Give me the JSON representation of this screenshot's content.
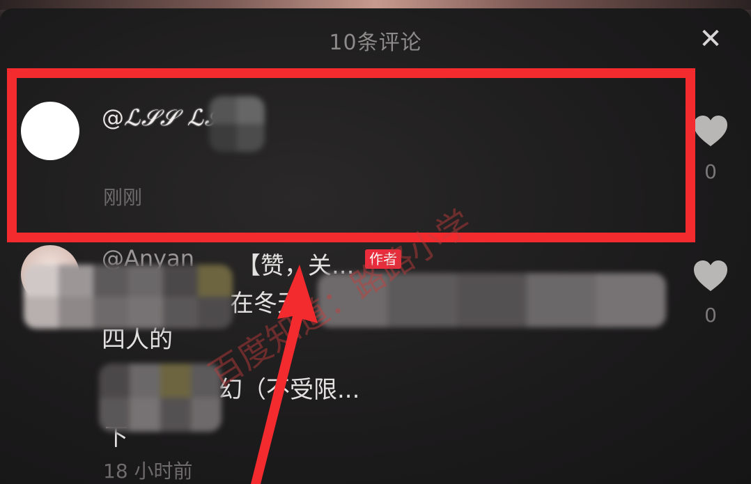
{
  "sheet": {
    "title": "10条评论",
    "close_symbol": "✕"
  },
  "comments": [
    {
      "username_prefix": "@",
      "username": "ℒ𝒮𝒮 ℒ𝒮𝒮ℰ",
      "time": "刚刚",
      "likes": "0"
    },
    {
      "username": "@Anyan",
      "snippet": "【赞，关...",
      "badge": "作者",
      "line2_visible": "在冬天",
      "line3_visible": "四人的",
      "line4_visible": "幻（不受限...",
      "line5_visible": "下",
      "time": "18 小时前",
      "likes": "0"
    }
  ],
  "watermark": {
    "text": "百度知道：路路小学"
  },
  "colors": {
    "highlight": "#f32a2e",
    "badge": "#ea2c3d",
    "sheet_bg": "#1c1b1c",
    "muted_text": "#6e6b6c"
  },
  "icons": {
    "close": "close-icon",
    "like": "heart-icon",
    "annotation": "red-arrow-icon"
  }
}
